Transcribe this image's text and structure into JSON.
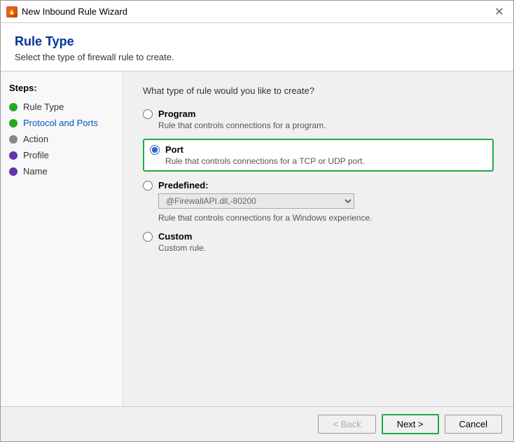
{
  "window": {
    "title": "New Inbound Rule Wizard",
    "close_label": "✕"
  },
  "header": {
    "title": "Rule Type",
    "subtitle": "Select the type of firewall rule to create."
  },
  "sidebar": {
    "steps_label": "Steps:",
    "items": [
      {
        "id": "rule-type",
        "label": "Rule Type",
        "dot": "green",
        "active": false
      },
      {
        "id": "protocol-and-ports",
        "label": "Protocol and Ports",
        "dot": "green",
        "active": true
      },
      {
        "id": "action",
        "label": "Action",
        "dot": "gray",
        "active": false
      },
      {
        "id": "profile",
        "label": "Profile",
        "dot": "purple",
        "active": false
      },
      {
        "id": "name",
        "label": "Name",
        "dot": "purple",
        "active": false
      }
    ]
  },
  "main": {
    "question": "What type of rule would you like to create?",
    "options": [
      {
        "id": "program",
        "label": "Program",
        "description": "Rule that controls connections for a program.",
        "selected": false,
        "highlighted": false
      },
      {
        "id": "port",
        "label": "Port",
        "description": "Rule that controls connections for a TCP or UDP port.",
        "selected": true,
        "highlighted": true
      },
      {
        "id": "predefined",
        "label": "Predefined:",
        "description": "Rule that controls connections for a Windows experience.",
        "selected": false,
        "highlighted": false,
        "dropdown_value": "@FirewallAPI.dll,-80200"
      },
      {
        "id": "custom",
        "label": "Custom",
        "description": "Custom rule.",
        "selected": false,
        "highlighted": false
      }
    ]
  },
  "footer": {
    "back_label": "< Back",
    "next_label": "Next >",
    "cancel_label": "Cancel"
  }
}
